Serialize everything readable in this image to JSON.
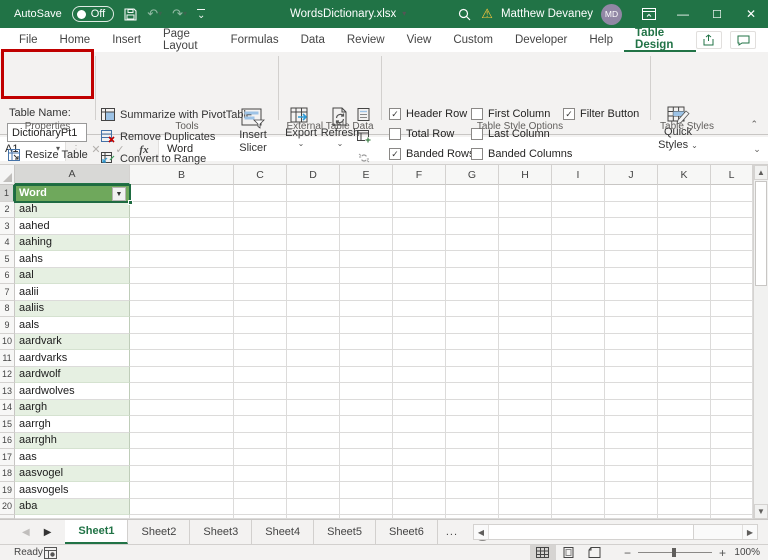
{
  "titlebar": {
    "autosave_label": "AutoSave",
    "autosave_state": "Off",
    "document_title": "WordsDictionary.xlsx",
    "user_name": "Matthew Devaney",
    "user_initials": "MD"
  },
  "ribbon_tabs": {
    "items": [
      {
        "label": "File"
      },
      {
        "label": "Home"
      },
      {
        "label": "Insert"
      },
      {
        "label": "Page Layout"
      },
      {
        "label": "Formulas"
      },
      {
        "label": "Data"
      },
      {
        "label": "Review"
      },
      {
        "label": "View"
      },
      {
        "label": "Custom"
      },
      {
        "label": "Developer"
      },
      {
        "label": "Help"
      },
      {
        "label": "Table Design",
        "active": true
      }
    ]
  },
  "ribbon": {
    "properties_group": {
      "table_name_label": "Table Name:",
      "table_name_value": "DictionaryPt1",
      "resize_table_label": "Resize Table",
      "group_label": "Properties"
    },
    "tools_group": {
      "buttons": [
        {
          "label": "Summarize with PivotTable",
          "icon": "pivottable-icon"
        },
        {
          "label": "Remove Duplicates",
          "icon": "remove-duplicates-icon"
        },
        {
          "label": "Convert to Range",
          "icon": "convert-to-range-icon"
        }
      ],
      "insert_slicer_line1": "Insert",
      "insert_slicer_line2": "Slicer",
      "group_label": "Tools"
    },
    "external_group": {
      "export_label": "Export",
      "refresh_label": "Refresh",
      "group_label": "External Table Data"
    },
    "style_options_group": {
      "checkboxes": [
        {
          "label": "Header Row",
          "checked": true
        },
        {
          "label": "Total Row",
          "checked": false
        },
        {
          "label": "Banded Rows",
          "checked": true
        },
        {
          "label": "First Column",
          "checked": false
        },
        {
          "label": "Last Column",
          "checked": false
        },
        {
          "label": "Banded Columns",
          "checked": false
        },
        {
          "label": "Filter Button",
          "checked": true
        }
      ],
      "columns": [
        [
          0,
          1,
          2
        ],
        [
          3,
          4,
          5
        ],
        [
          6
        ]
      ],
      "group_label": "Table Style Options"
    },
    "table_styles_group": {
      "quick_styles_line1": "Quick",
      "quick_styles_line2": "Styles",
      "group_label": "Table Styles"
    }
  },
  "formula_bar": {
    "name_box": "A1",
    "formula_value": "Word"
  },
  "grid": {
    "columns": [
      "A",
      "B",
      "C",
      "D",
      "E",
      "F",
      "G",
      "H",
      "I",
      "J",
      "K",
      "L"
    ],
    "selected_column": "A",
    "selected_cell": "A1",
    "header_cell": "Word",
    "words": [
      "aah",
      "aahed",
      "aahing",
      "aahs",
      "aal",
      "aalii",
      "aaliis",
      "aals",
      "aardvark",
      "aardvarks",
      "aardwolf",
      "aardwolves",
      "aargh",
      "aarrgh",
      "aarrghh",
      "aas",
      "aasvogel",
      "aasvogels",
      "aba"
    ]
  },
  "sheet_bar": {
    "tabs": [
      {
        "label": "Sheet1",
        "active": true
      },
      {
        "label": "Sheet2"
      },
      {
        "label": "Sheet3"
      },
      {
        "label": "Sheet4"
      },
      {
        "label": "Sheet5"
      },
      {
        "label": "Sheet6"
      }
    ],
    "more_label": "..."
  },
  "status_bar": {
    "status": "Ready",
    "zoom_level": "100%"
  },
  "colors": {
    "excel_green": "#217346",
    "table_header_green": "#6fa85c",
    "banded_row_green": "#e6f0e2",
    "annotation_red": "#C00000",
    "warning_yellow": "#FFC83D"
  }
}
